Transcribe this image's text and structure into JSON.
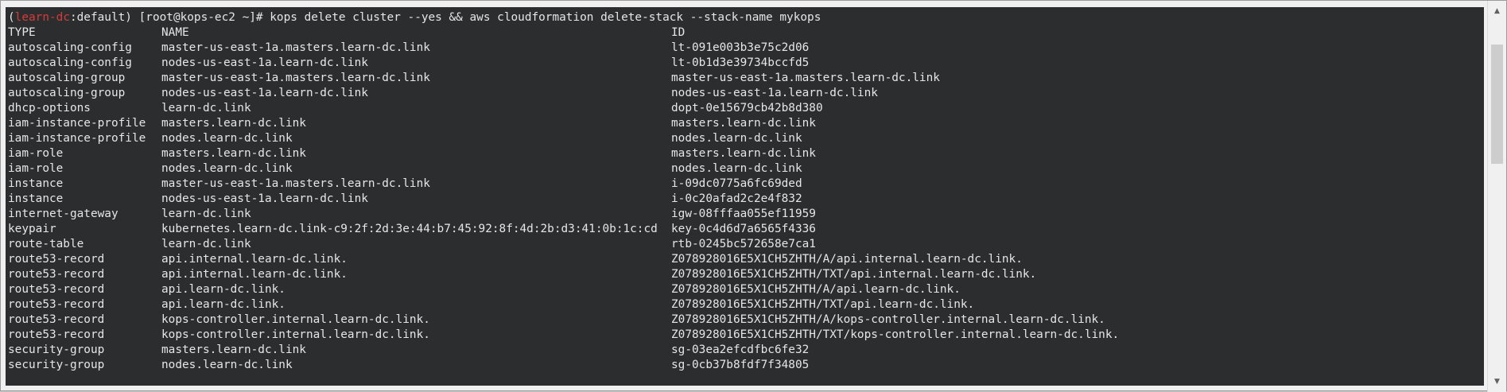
{
  "prompt": {
    "open_paren": "(",
    "env": "learn-dc",
    "context": ":default) ",
    "user_host": "[root@kops-ec2 ~]# ",
    "command": "kops delete cluster --yes && aws cloudformation delete-stack --stack-name mykops"
  },
  "table": {
    "headers": {
      "type": "TYPE",
      "name": "NAME",
      "id": "ID"
    },
    "rows": [
      {
        "type": "autoscaling-config",
        "name": "master-us-east-1a.masters.learn-dc.link",
        "id": "lt-091e003b3e75c2d06"
      },
      {
        "type": "autoscaling-config",
        "name": "nodes-us-east-1a.learn-dc.link",
        "id": "lt-0b1d3e39734bccfd5"
      },
      {
        "type": "autoscaling-group",
        "name": "master-us-east-1a.masters.learn-dc.link",
        "id": "master-us-east-1a.masters.learn-dc.link"
      },
      {
        "type": "autoscaling-group",
        "name": "nodes-us-east-1a.learn-dc.link",
        "id": "nodes-us-east-1a.learn-dc.link"
      },
      {
        "type": "dhcp-options",
        "name": "learn-dc.link",
        "id": "dopt-0e15679cb42b8d380"
      },
      {
        "type": "iam-instance-profile",
        "name": "masters.learn-dc.link",
        "id": "masters.learn-dc.link"
      },
      {
        "type": "iam-instance-profile",
        "name": "nodes.learn-dc.link",
        "id": "nodes.learn-dc.link"
      },
      {
        "type": "iam-role",
        "name": "masters.learn-dc.link",
        "id": "masters.learn-dc.link"
      },
      {
        "type": "iam-role",
        "name": "nodes.learn-dc.link",
        "id": "nodes.learn-dc.link"
      },
      {
        "type": "instance",
        "name": "master-us-east-1a.masters.learn-dc.link",
        "id": "i-09dc0775a6fc69ded"
      },
      {
        "type": "instance",
        "name": "nodes-us-east-1a.learn-dc.link",
        "id": "i-0c20afad2c2e4f832"
      },
      {
        "type": "internet-gateway",
        "name": "learn-dc.link",
        "id": "igw-08fffaa055ef11959"
      },
      {
        "type": "keypair",
        "name": "kubernetes.learn-dc.link-c9:2f:2d:3e:44:b7:45:92:8f:4d:2b:d3:41:0b:1c:cd",
        "id": "key-0c4d6d7a6565f4336"
      },
      {
        "type": "route-table",
        "name": "learn-dc.link",
        "id": "rtb-0245bc572658e7ca1"
      },
      {
        "type": "route53-record",
        "name": "api.internal.learn-dc.link.",
        "id": "Z078928016E5X1CH5ZHTH/A/api.internal.learn-dc.link."
      },
      {
        "type": "route53-record",
        "name": "api.internal.learn-dc.link.",
        "id": "Z078928016E5X1CH5ZHTH/TXT/api.internal.learn-dc.link."
      },
      {
        "type": "route53-record",
        "name": "api.learn-dc.link.",
        "id": "Z078928016E5X1CH5ZHTH/A/api.learn-dc.link."
      },
      {
        "type": "route53-record",
        "name": "api.learn-dc.link.",
        "id": "Z078928016E5X1CH5ZHTH/TXT/api.learn-dc.link."
      },
      {
        "type": "route53-record",
        "name": "kops-controller.internal.learn-dc.link.",
        "id": "Z078928016E5X1CH5ZHTH/A/kops-controller.internal.learn-dc.link."
      },
      {
        "type": "route53-record",
        "name": "kops-controller.internal.learn-dc.link.",
        "id": "Z078928016E5X1CH5ZHTH/TXT/kops-controller.internal.learn-dc.link."
      },
      {
        "type": "security-group",
        "name": "masters.learn-dc.link",
        "id": "sg-03ea2efcdfbc6fe32"
      },
      {
        "type": "security-group",
        "name": "nodes.learn-dc.link",
        "id": "sg-0cb37b8fdf7f34805"
      }
    ]
  },
  "scrollbar": {
    "up_icon": "▲",
    "down_icon": "▼",
    "position": 0.1
  },
  "colors": {
    "terminal_bg": "#2b2d2e",
    "text": "#e6e6e6",
    "env_highlight": "#d63c3c"
  }
}
